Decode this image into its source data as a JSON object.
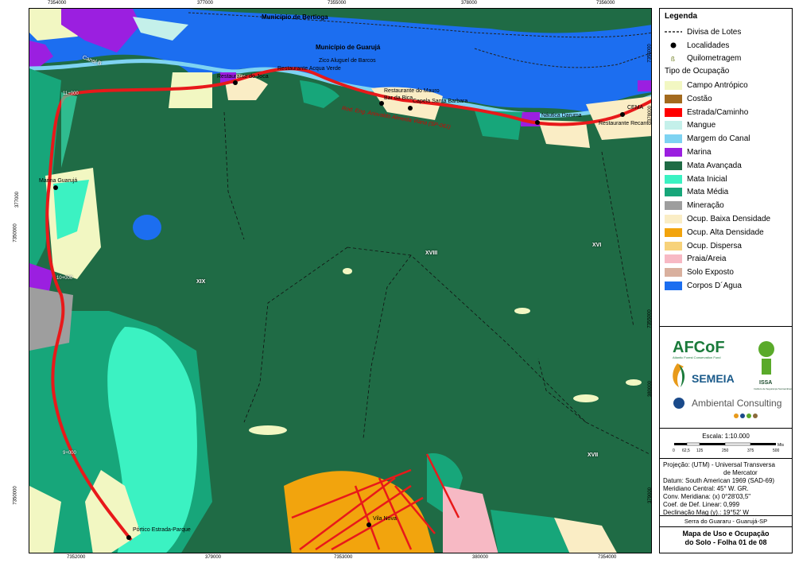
{
  "legend": {
    "title": "Legenda",
    "line_items": [
      {
        "label": "Divisa de Lotes",
        "type": "dashed"
      },
      {
        "label": "Localidades",
        "type": "dot"
      },
      {
        "label": "Quilometragem",
        "type": "km"
      }
    ],
    "occupation_title": "Tipo de Ocupação",
    "occupation_items": [
      {
        "label": "Campo Antrópico",
        "color": "#f2f7c2"
      },
      {
        "label": "Costão",
        "color": "#a36a1e"
      },
      {
        "label": "Estrada/Caminho",
        "color": "#ff0000"
      },
      {
        "label": "Mangue",
        "color": "#c4f0ea"
      },
      {
        "label": "Margem do Canal",
        "color": "#7ed3f2"
      },
      {
        "label": "Marina",
        "color": "#9b1fe0"
      },
      {
        "label": "Mata Avançada",
        "color": "#1f6b45"
      },
      {
        "label": "Mata Inicial",
        "color": "#3bf2c2"
      },
      {
        "label": "Mata Média",
        "color": "#17a67a"
      },
      {
        "label": "Mineração",
        "color": "#9e9e9e"
      },
      {
        "label": "Ocup. Baixa Densidade",
        "color": "#faedc5"
      },
      {
        "label": "Ocup. Alta Densidade",
        "color": "#f2a40d"
      },
      {
        "label": "Ocup. Dispersa",
        "color": "#f7d27a"
      },
      {
        "label": "Praia/Areia",
        "color": "#f7b9c4"
      },
      {
        "label": "Solo Exposto",
        "color": "#d9b09e"
      },
      {
        "label": "Corpos D´Agua",
        "color": "#1c6ef0"
      }
    ]
  },
  "logos": {
    "afcof": "AFCoF",
    "afcof_sub": "Atlantic Forest Conservation Fund",
    "semeia": "SEMEIA",
    "issa": "ISSA",
    "issa_sub": "Instituto de Segurança Socioambiental",
    "ambiental": "Ambiental Consulting"
  },
  "scale": {
    "label": "Escala: 1:10.000",
    "ticks": [
      "0",
      "62,5",
      "125",
      "250",
      "375",
      "500"
    ],
    "unit": "Mts"
  },
  "projection": {
    "line1": "Projeção: (UTM) - Universal Transversa",
    "line2": "de Mercator",
    "datum": "Datum: South American 1969 (SAD-69)",
    "meridian": "Meridiano Central: 45° W. GR.",
    "conv": "Conv. Meridiana: (x) 0°28'03,5\"",
    "coef": "Coef. de Def. Linear: 0,999",
    "decl": "Declinação Mag (y).: 19°52' W"
  },
  "place": "Serra do Guararu - Guarujá-SP",
  "title": {
    "line1": "Mapa de Uso e Ocupação",
    "line2": "do Solo - Folha 01 de 08"
  },
  "coords": {
    "top": [
      "7354000",
      "377000",
      "7355000",
      "378000",
      "7356000"
    ],
    "bottom": [
      "7352000",
      "379000",
      "7353000",
      "380000",
      "7354000"
    ],
    "left": [
      "377000",
      "7350000",
      "7350000"
    ],
    "right": [
      "7356000",
      "378000",
      "7355000",
      "380000",
      "379000"
    ]
  },
  "labels": {
    "bertioga": "Município de Bertioga",
    "guaruja": "Município de Guarujá",
    "canal": "Canal B",
    "road": "Rod. Eng. Ariovaldo Almeida Viana (SP-061)",
    "places": [
      "Restaurante do Joca",
      "Restaurante Acqua Verde",
      "Zico Aluguel de Barcos",
      "Restaurante do Mauro",
      "Bar da Bica",
      "Capela Santa Barbara",
      "Náutica Daruma",
      "CEMA",
      "Restaurante Recanto",
      "Marina Guarujá",
      "Vila Nova",
      "Pórtico Estrada-Parque"
    ],
    "zones": [
      "XIX",
      "XVIII",
      "XVI",
      "XVII"
    ],
    "km": [
      "11+000",
      "10+000",
      "9+000"
    ]
  }
}
